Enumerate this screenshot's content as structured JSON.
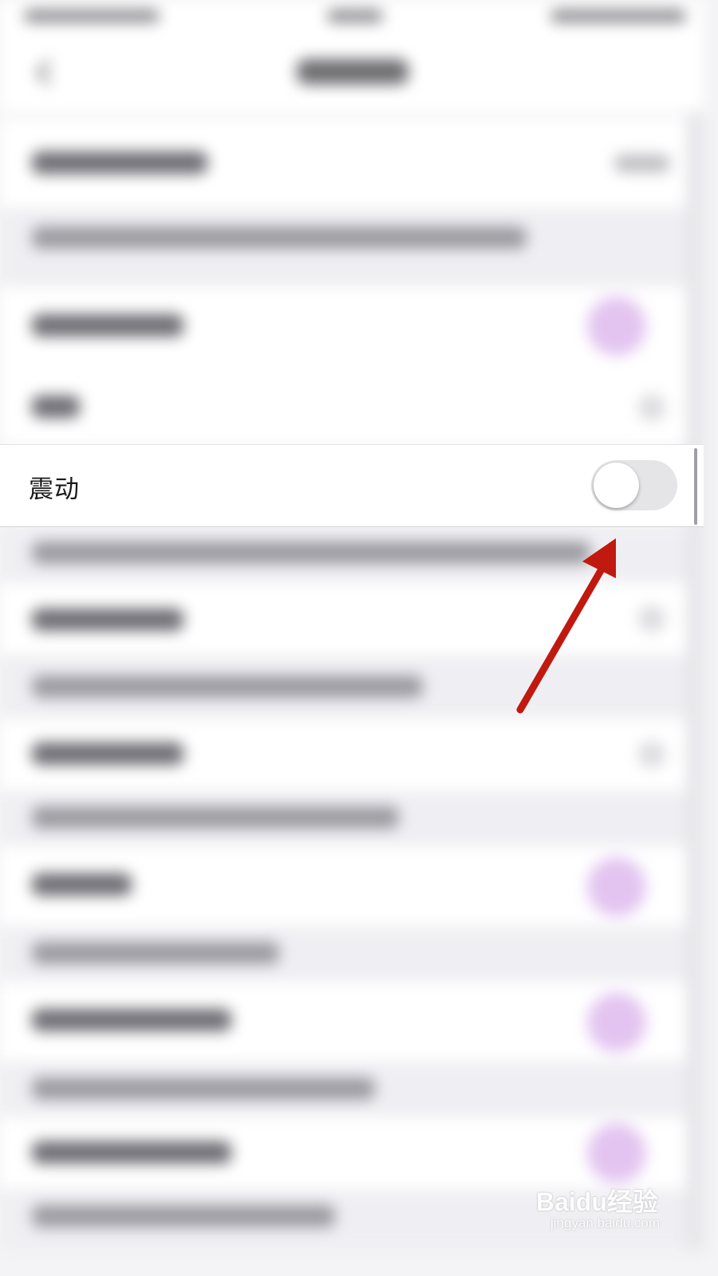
{
  "vibration": {
    "label": "震动",
    "toggle_on": false
  },
  "colors": {
    "annotation_arrow": "#c0190f",
    "toggle_off_track": "#e5e5e8",
    "toggle_ghost_on": "#e3c4f0"
  },
  "watermark": {
    "logo": "Baidu经验",
    "url": "jingyan.baidu.com"
  }
}
